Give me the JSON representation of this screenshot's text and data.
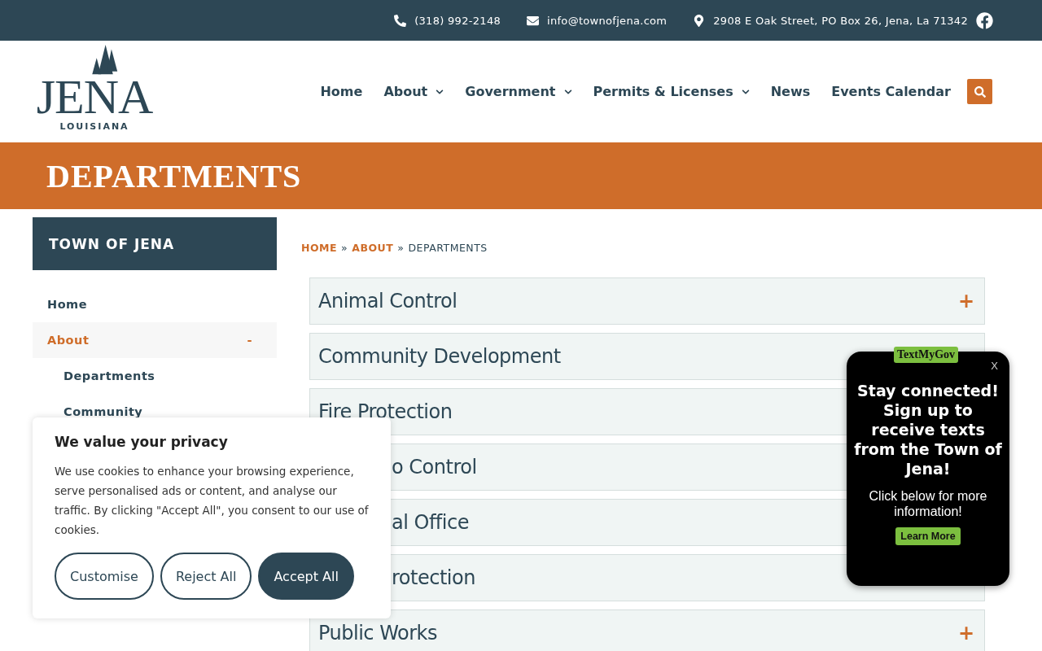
{
  "top_bar": {
    "phone": "(318) 992-2148",
    "email": "info@townofjena.com",
    "address": "2908 E Oak Street, PO Box 26, Jena, La 71342"
  },
  "logo": {
    "name": "JENA",
    "subtitle": "LOUISIANA"
  },
  "nav": [
    {
      "label": "Home",
      "dropdown": false
    },
    {
      "label": "About",
      "dropdown": true
    },
    {
      "label": "Government",
      "dropdown": true
    },
    {
      "label": "Permits & Licenses",
      "dropdown": true
    },
    {
      "label": "News",
      "dropdown": false
    },
    {
      "label": "Events Calendar",
      "dropdown": false
    }
  ],
  "banner": {
    "title": "DEPARTMENTS"
  },
  "sidebar": {
    "title": "TOWN OF JENA",
    "items": [
      {
        "label": "Home",
        "selected": false
      },
      {
        "label": "About",
        "selected": true,
        "toggle": "-",
        "children": [
          {
            "label": "Departments",
            "selected": false
          },
          {
            "label": "Community",
            "selected": false
          }
        ]
      }
    ]
  },
  "breadcrumb": [
    {
      "label": "HOME",
      "link": true
    },
    {
      "label": "ABOUT",
      "link": true
    },
    {
      "label": "DEPARTMENTS",
      "link": false
    }
  ],
  "breadcrumb_separator": "»",
  "departments": [
    {
      "title": "Animal Control",
      "toggle": "+"
    },
    {
      "title": "Community Development"
    },
    {
      "title": "Fire Protection"
    },
    {
      "title": "o Control",
      "partial": true
    },
    {
      "title": "al Office",
      "partial": true
    },
    {
      "title": "rotection",
      "partial": true
    },
    {
      "title": "Public Works",
      "toggle": "+"
    }
  ],
  "cookie_banner": {
    "title": "We value your privacy",
    "text": "We use cookies to enhance your browsing experience, serve personalised ads or content, and analyse our traffic. By clicking \"Accept All\", you consent to our use of cookies.",
    "buttons": [
      {
        "label": "Customise",
        "primary": false
      },
      {
        "label": "Reject All",
        "primary": false
      },
      {
        "label": "Accept All",
        "primary": true
      }
    ]
  },
  "text_widget": {
    "brand": "TextMyGov",
    "close": "X",
    "headline": "Stay connected! Sign up to receive texts from the Town of Jena!",
    "text": "Click below for more information!",
    "button": "Learn More"
  }
}
